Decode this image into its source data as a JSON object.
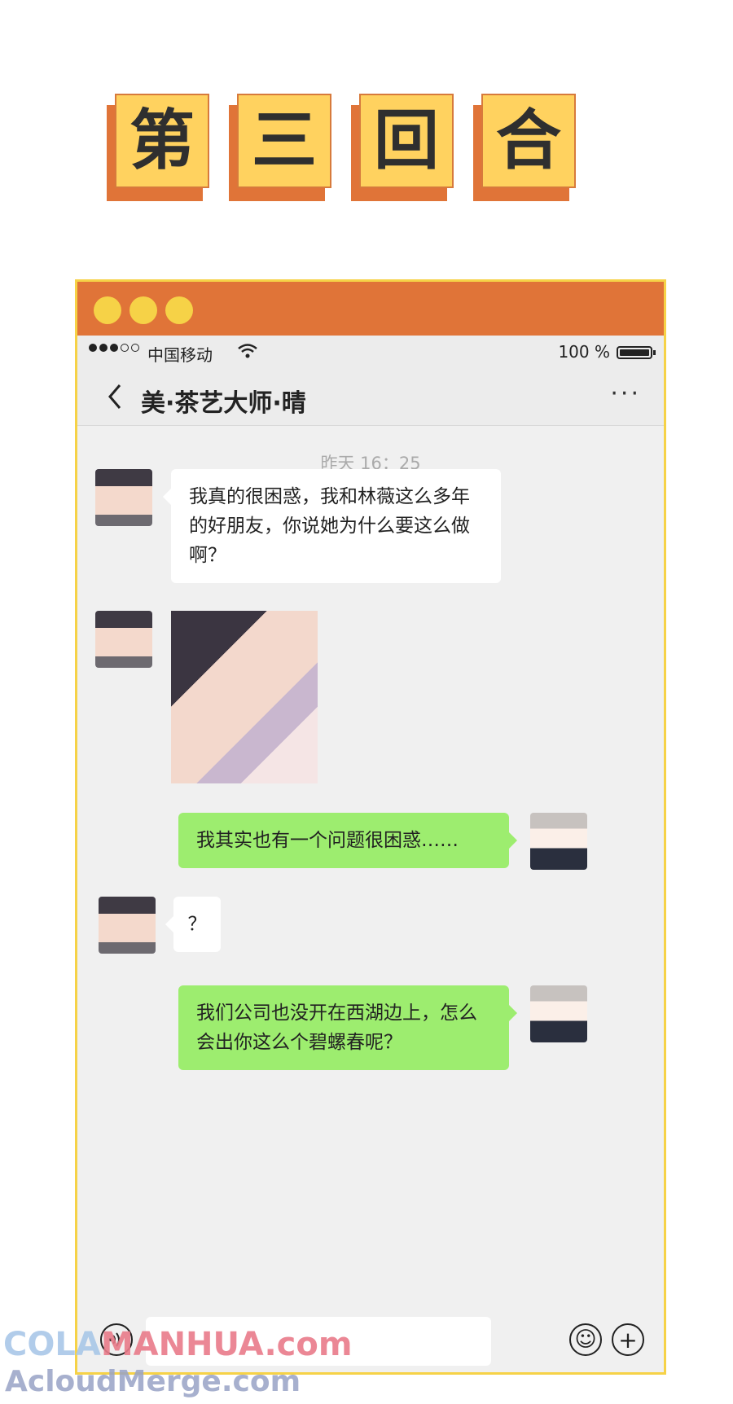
{
  "titles": [
    "第",
    "三",
    "回",
    "合"
  ],
  "colors": {
    "title_chip": "#ffd25f",
    "title_shadow": "#e07438",
    "window_border": "#f6d247",
    "titlebar": "#e07438",
    "bubble_green": "#9ded6f"
  },
  "status": {
    "carrier": "中国移动",
    "battery": "100 %"
  },
  "chat": {
    "title": "美·茶艺大师·晴",
    "back_icon": "chevron-left-icon",
    "more": "···"
  },
  "timestamp": "昨天 16：25",
  "messages": [
    {
      "sender": "left",
      "text": "我真的很困惑，我和林薇这么多年的好朋友，你说她为什么要这么做啊？"
    },
    {
      "sender": "left",
      "type": "image"
    },
    {
      "sender": "right",
      "text": "我其实也有一个问题很困惑……"
    },
    {
      "sender": "left",
      "text": "？"
    },
    {
      "sender": "right",
      "text": "我们公司也没开在西湖边上，怎么会出你这么个碧螺春呢？"
    }
  ],
  "watermark": {
    "line1_a": "COLA",
    "line1_b": "MANHUA.com",
    "line2": "AcloudMerge.com"
  }
}
